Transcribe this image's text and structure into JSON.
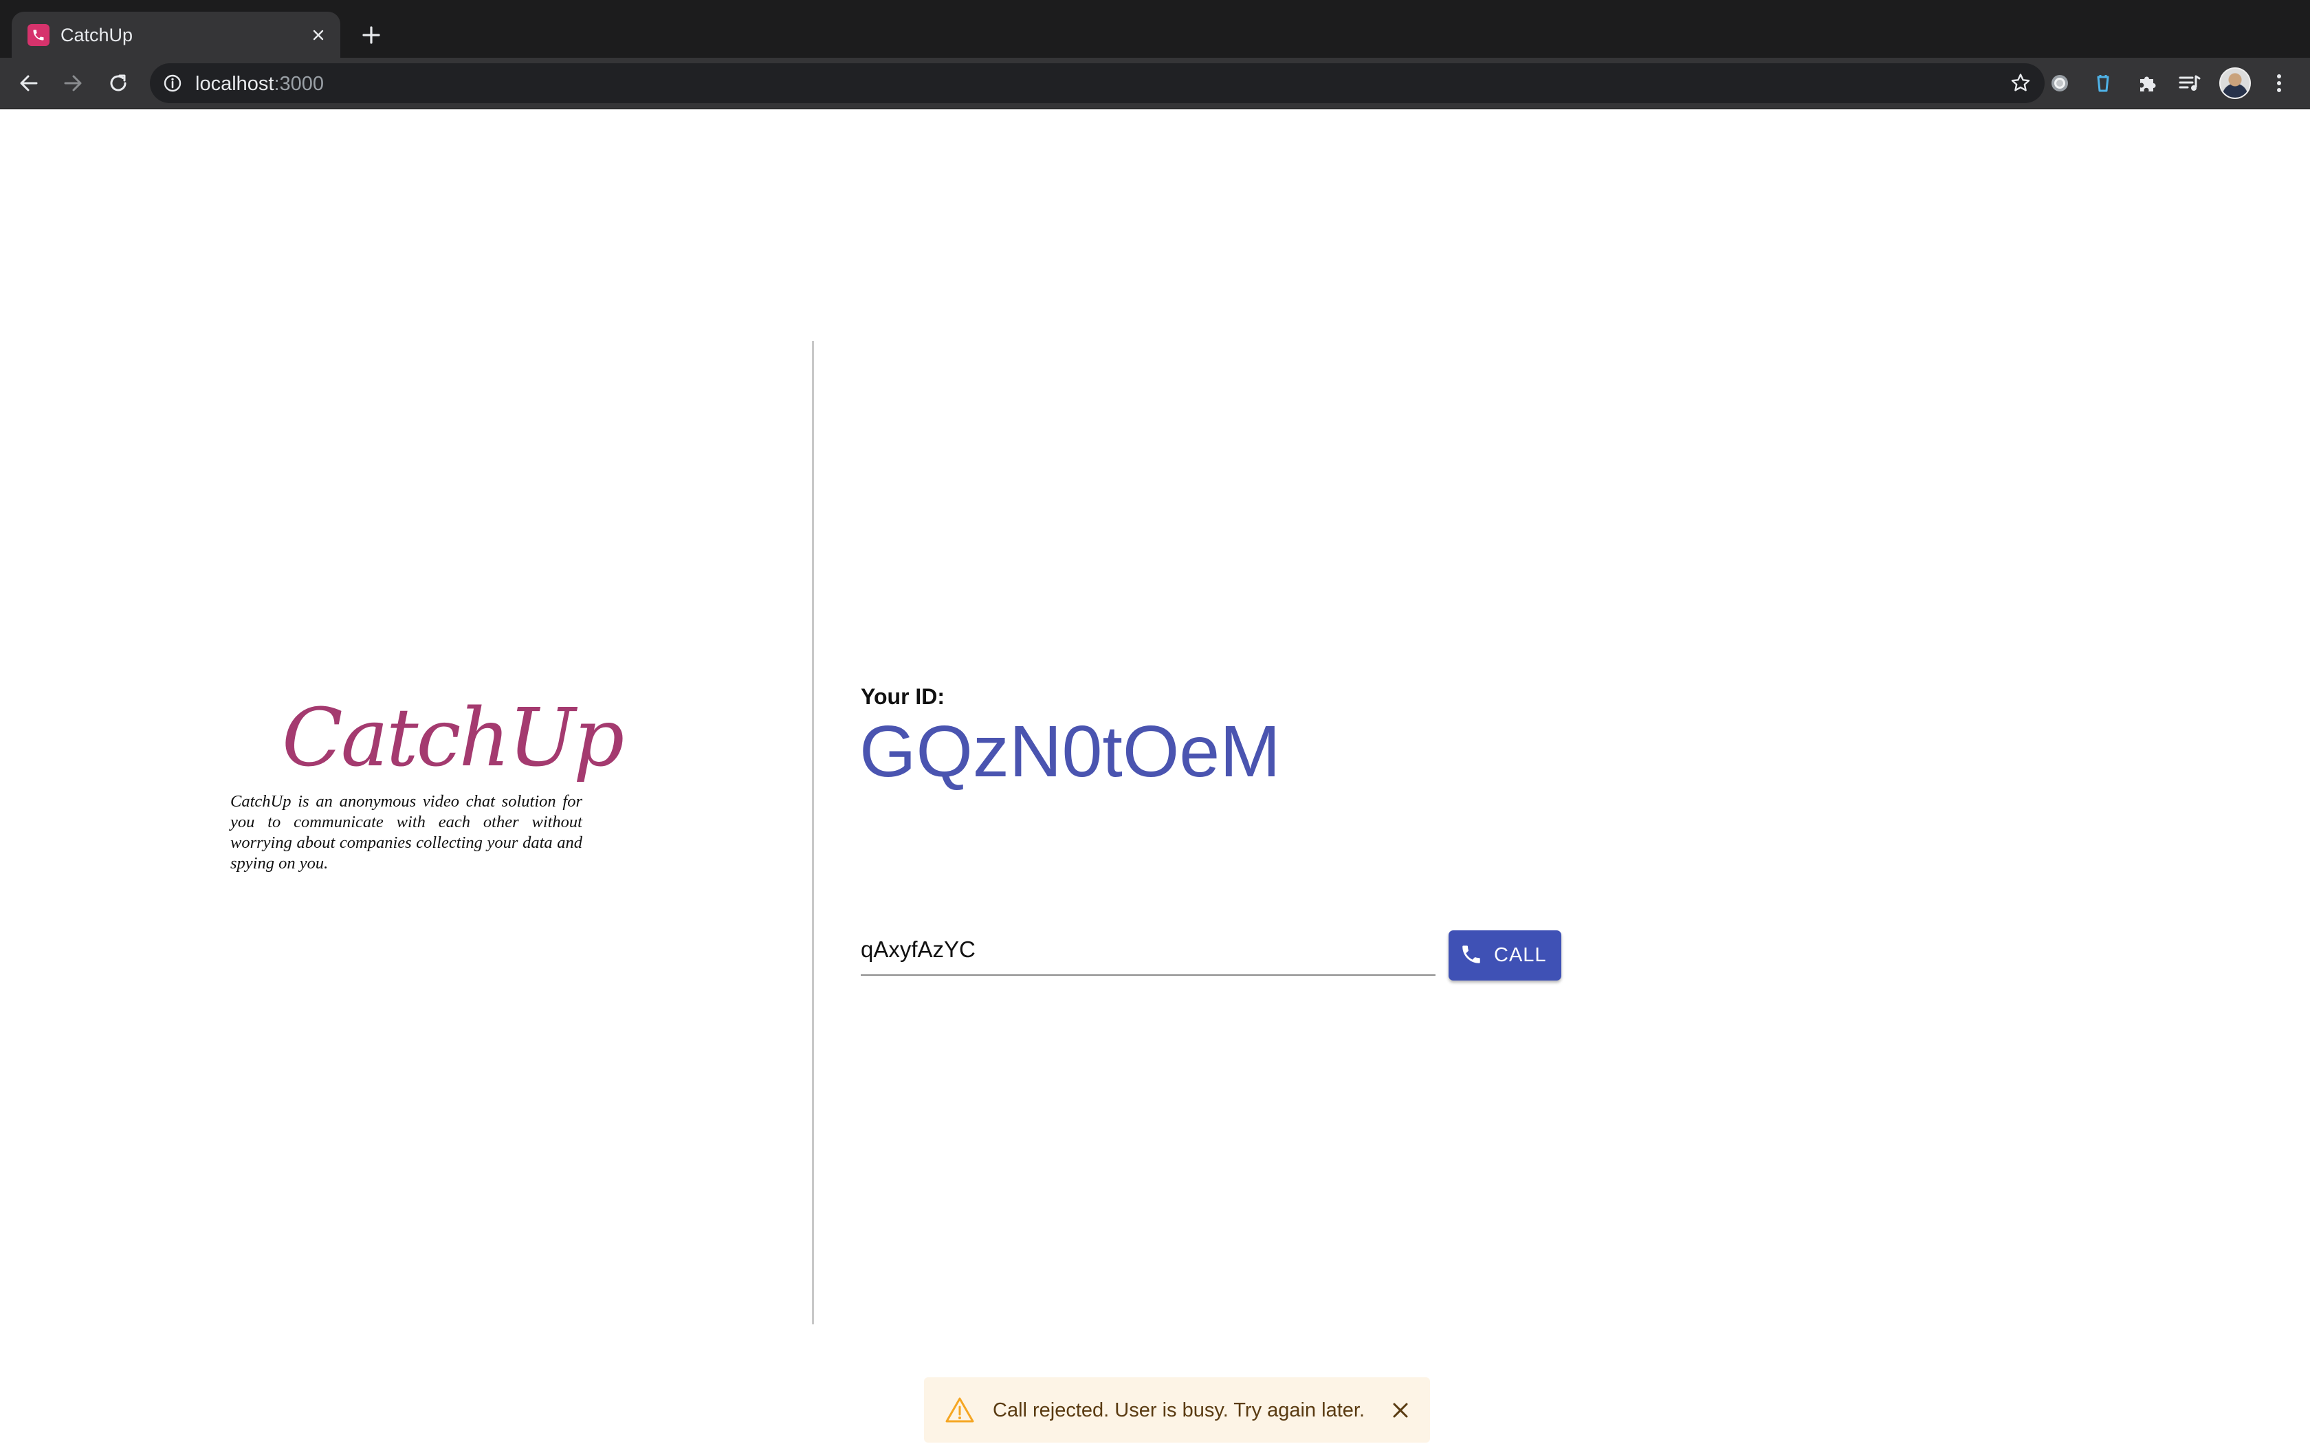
{
  "browser": {
    "tab": {
      "title": "CatchUp",
      "favicon": "phone-icon"
    },
    "address": {
      "host": "localhost",
      "port": ":3000"
    },
    "icons": [
      "back-arrow-icon",
      "forward-arrow-icon",
      "reload-icon",
      "info-icon",
      "star-icon",
      "extension-icon",
      "puzzle-icon",
      "media-queue-icon",
      "avatar",
      "kebab-menu-icon"
    ]
  },
  "brand": {
    "logo_text": "CatchUp",
    "description": "CatchUp is an anonymous video chat solution for you to communicate with each other without worrying about companies collecting your data and spying on you."
  },
  "main": {
    "id_label": "Your ID:",
    "id_value": "GQzN0tOeM",
    "call_input_value": "qAxyfAzYC",
    "call_button_label": "CALL",
    "call_button_icon": "phone-icon"
  },
  "snackbar": {
    "message": "Call rejected. User is busy. Try again later.",
    "icon": "warning-icon",
    "close_icon": "close-icon"
  },
  "colors": {
    "brand": "#a43a6f",
    "id_value": "#4a54b0",
    "primary_button": "#3f51b5",
    "snackbar_bg": "#fdf4e6",
    "warning": "#f5a623"
  }
}
